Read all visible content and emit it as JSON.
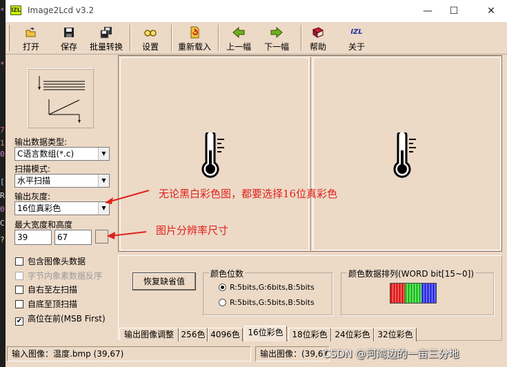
{
  "window": {
    "icon_text": "IZL",
    "title": "Image2Lcd v3.2",
    "minimize_glyph": "—",
    "maximize_glyph": "☐",
    "close_glyph": "✕"
  },
  "toolbar": {
    "buttons": [
      {
        "label": "打开",
        "icon": "open-folder-icon"
      },
      {
        "label": "保存",
        "icon": "save-disk-icon"
      },
      {
        "label": "批量转换",
        "icon": "batch-convert-icon"
      },
      {
        "label": "设置",
        "icon": "settings-glasses-icon"
      },
      {
        "label": "重新载入",
        "icon": "reload-icon"
      },
      {
        "label": "上一幅",
        "icon": "arrow-left-icon"
      },
      {
        "label": "下一幅",
        "icon": "arrow-right-icon"
      },
      {
        "label": "帮助",
        "icon": "help-book-icon"
      },
      {
        "label": "关于",
        "icon": "about-logo-icon"
      }
    ],
    "about_logo_text": "IZL"
  },
  "left_panel": {
    "output_type_label": "输出数据类型:",
    "output_type_value": "C语言数组(*.c)",
    "scan_mode_label": "扫描模式:",
    "scan_mode_value": "水平扫描",
    "gray_label": "输出灰度:",
    "gray_value": "16位真彩色",
    "size_label": "最大宽度和高度",
    "width_value": "39",
    "height_value": "67",
    "checkboxes": [
      {
        "label": "包含图像头数据",
        "checked": false,
        "disabled": false
      },
      {
        "label": "字节内象素数据反序",
        "checked": false,
        "disabled": true
      },
      {
        "label": "自右至左扫描",
        "checked": false,
        "disabled": false
      },
      {
        "label": "自底至顶扫描",
        "checked": false,
        "disabled": false
      },
      {
        "label": "高位在前(MSB First)",
        "checked": true,
        "disabled": false
      }
    ]
  },
  "bottom_panel": {
    "restore_button": "恢复缺省值",
    "color_bits_legend": "颜色位数",
    "radio_options": [
      {
        "label": "R:5bits,G:6bits,B:5bits",
        "selected": true
      },
      {
        "label": "R:5bits,G:5bits,B:5bits",
        "selected": false
      }
    ],
    "color_order_legend": "颜色数据排列(WORD bit[15~0])",
    "colors": {
      "red": "#e02020",
      "green": "#20c020",
      "blue": "#3030e0"
    }
  },
  "tabs": [
    {
      "label": "输出图像调整",
      "active": false
    },
    {
      "label": "256色",
      "active": false
    },
    {
      "label": "4096色",
      "active": false
    },
    {
      "label": "16位彩色",
      "active": true
    },
    {
      "label": "18位彩色",
      "active": false
    },
    {
      "label": "24位彩色",
      "active": false
    },
    {
      "label": "32位彩色",
      "active": false
    }
  ],
  "status": {
    "input_image": "输入图像：温度.bmp (39,67)",
    "output_image": "输出图像：(39,67)"
  },
  "annotations": {
    "note_color": "无论黑白彩色图，都要选择16位真彩色",
    "note_size": "图片分辨率尺寸",
    "color": "#e0211c"
  },
  "watermark": "CSDN @河湾边的一亩三分地",
  "editor_glyphs": [
    "*",
    "*",
    "7",
    "1",
    "0",
    "[",
    "R",
    "0",
    "C",
    "?"
  ]
}
